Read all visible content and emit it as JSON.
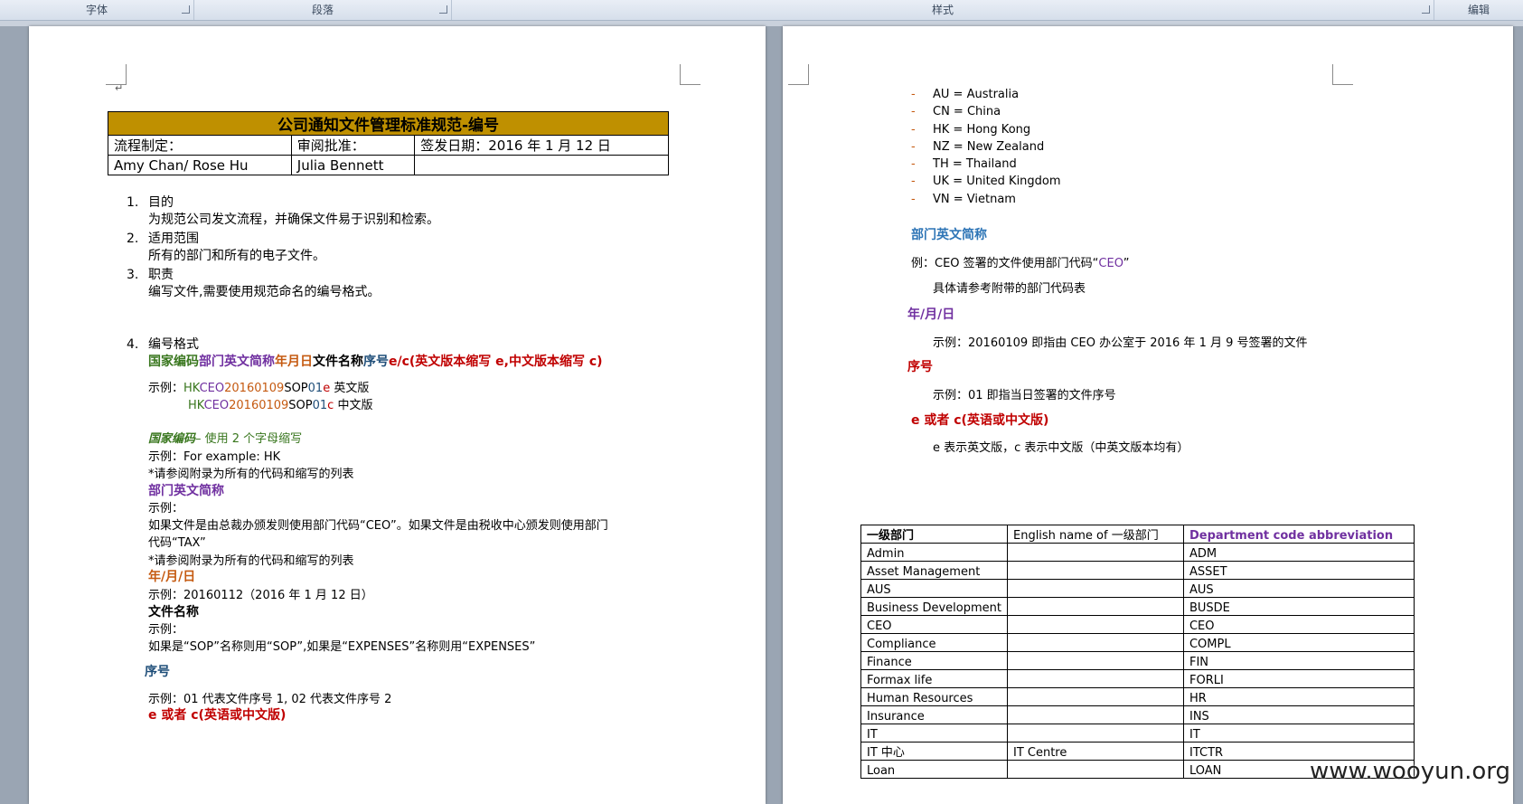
{
  "ribbon": {
    "font_group": "字体",
    "paragraph_group": "段落",
    "styles_group": "样式",
    "edit_group": "编辑"
  },
  "header_table": {
    "title": "公司通知文件管理标准规范-编号",
    "row1": [
      "流程制定：",
      "审阅批准：",
      "签发日期：2016 年 1 月 12 日"
    ],
    "row2": [
      "Amy Chan/ Rose Hu",
      "Julia Bennett",
      ""
    ]
  },
  "sections": [
    {
      "num": "1.",
      "title": "目的",
      "body": "为规范公司发文流程，并确保文件易于识别和检索。"
    },
    {
      "num": "2.",
      "title": "适用范围",
      "body": "所有的部门和所有的电子文件。"
    },
    {
      "num": "3.",
      "title": "职责",
      "body": "编写文件,需要使用规范命名的编号格式。"
    },
    {
      "num": "4.",
      "title": "编号格式",
      "body": ""
    }
  ],
  "format_line": {
    "country": "国家编码",
    "dept": "部门英文简称",
    "date": "年月日",
    "name": "文件名称",
    "seq": "序号",
    "lang": "e/c(英文版本缩写 e,中文版本缩写 c)"
  },
  "example": {
    "label": "示例：",
    "line1": {
      "country": "HK",
      "dept": "CEO",
      "date": "20160109",
      "name": "SOP",
      "seq": "01",
      "lang": "e",
      "desc": "英文版"
    },
    "line2": {
      "country": "HK",
      "dept": "CEO",
      "date": "20160109",
      "name": "SOP",
      "seq": "01",
      "lang": "c",
      "desc": "中文版"
    }
  },
  "page1_details": {
    "country_heading": "国家编码",
    "country_desc": "– 使用 2 个字母缩写",
    "country_ex": "示例：For example: HK",
    "appendix_note_1": "*请参阅附录为所有的代码和缩写的列表",
    "dept_heading": "部门英文简称",
    "dept_ex": "示例：",
    "dept_text_1": "如果文件是由总裁办颁发则使用部门代码“CEO”。如果文件是由税收中心颁发则使用部门",
    "dept_text_2": "代码“TAX”",
    "appendix_note_2": "*请参阅附录为所有的代码和缩写的列表",
    "date_heading": "年/月/日",
    "date_ex": "示例：20160112（2016 年 1 月 12 日）",
    "name_heading": "文件名称",
    "name_ex": "示例：",
    "name_text": "如果是“SOP”名称则用“SOP”,如果是“EXPENSES”名称则用“EXPENSES”",
    "seq_heading": "序号",
    "seq_ex": "示例：01 代表文件序号 1, 02 代表文件序号 2",
    "lang_heading": "e 或者 c(英语或中文版)"
  },
  "countries": [
    "AU = Australia",
    "CN = China",
    "HK = Hong Kong",
    "NZ = New Zealand",
    "TH = Thailand",
    "UK = United Kingdom",
    "VN = Vietnam"
  ],
  "page2_details": {
    "dept_heading": "部门英文简称",
    "dept_ex_prefix": "例：CEO 签署的文件使用部门代码“",
    "dept_ex_code": "CEO",
    "dept_ex_suffix": "”",
    "dept_ref": "具体请参考附带的部门代码表",
    "date_heading": "年/月/日",
    "date_ex": "示例：20160109 即指由 CEO 办公室于 2016 年 1 月 9 号签署的文件",
    "seq_heading": "序号",
    "seq_ex": "示例：01 即指当日签署的文件序号",
    "lang_heading": "e 或者 c(英语或中文版)",
    "lang_desc": "e 表示英文版，c 表示中文版（中英文版本均有）"
  },
  "dept_table": {
    "headers": [
      "一级部门",
      "English name of 一级部门",
      "Department code abbreviation"
    ],
    "rows": [
      [
        "Admin",
        "",
        "ADM"
      ],
      [
        "Asset Management",
        "",
        "ASSET"
      ],
      [
        "AUS",
        "",
        "AUS"
      ],
      [
        "Business Development",
        "",
        "BUSDE"
      ],
      [
        "CEO",
        "",
        "CEO"
      ],
      [
        "Compliance",
        "",
        "COMPL"
      ],
      [
        "Finance",
        "",
        "FIN"
      ],
      [
        "Formax life",
        "",
        "FORLI"
      ],
      [
        "Human Resources",
        "",
        "HR"
      ],
      [
        "Insurance",
        "",
        "INS"
      ],
      [
        "IT",
        "",
        "IT"
      ],
      [
        "IT 中心",
        "IT Centre",
        "ITCTR"
      ],
      [
        "Loan",
        "",
        "LOAN"
      ]
    ]
  },
  "watermark": "www.wooyun.org",
  "colors": {
    "header_fill": "#bf9000",
    "red": "#c00000",
    "orange": "#c55a11",
    "purple": "#7030a0",
    "green": "#38761d",
    "blue": "#1f4e79"
  }
}
